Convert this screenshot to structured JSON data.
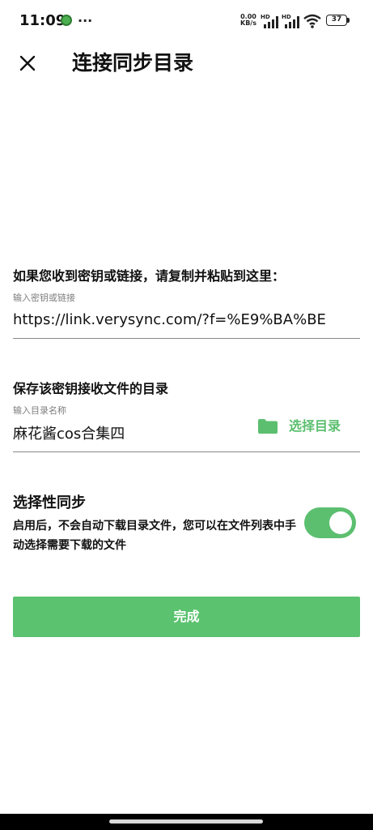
{
  "status_bar": {
    "time": "11:09",
    "dots": "···",
    "speed_value": "0.00",
    "speed_unit": "KB/s",
    "battery": "37"
  },
  "header": {
    "title": "连接同步目录",
    "close_icon": "close-icon"
  },
  "key_section": {
    "label": "如果您收到密钥或链接，请复制并粘贴到这里：",
    "hint": "输入密钥或链接",
    "value": "https://link.verysync.com/?f=%E9%BA%BE"
  },
  "dir_section": {
    "label": "保存该密钥接收文件的目录",
    "hint": "输入目录名称",
    "value": "麻花酱cos合集四",
    "select_button": "选择目录",
    "folder_icon": "folder-icon"
  },
  "selective_sync": {
    "title": "选择性同步",
    "desc": "启用后，不会自动下载目录文件，您可以在文件列表中手动选择需要下载的文件",
    "enabled": true
  },
  "done_button": "完成",
  "colors": {
    "accent": "#5bc26f",
    "text": "#111111",
    "hint": "#7d7d7d"
  }
}
